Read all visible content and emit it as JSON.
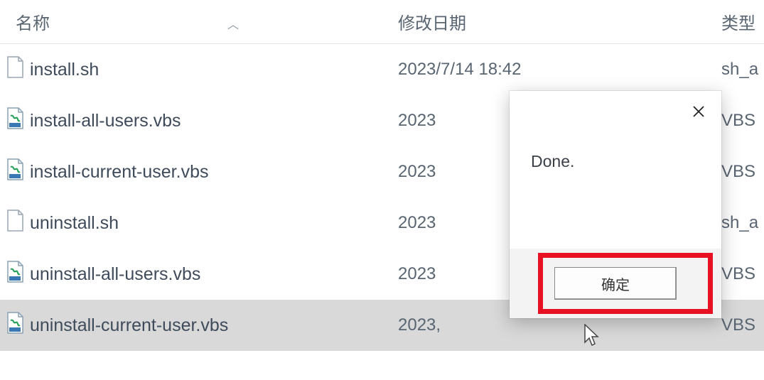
{
  "columns": {
    "name": "名称",
    "date": "修改日期",
    "type": "类型"
  },
  "rows": [
    {
      "icon": "generic",
      "name": "install.sh",
      "date": "2023/7/14 18:42",
      "type": "sh_a",
      "selected": false
    },
    {
      "icon": "vbs",
      "name": "install-all-users.vbs",
      "date": "2023",
      "type": "VBS",
      "selected": false
    },
    {
      "icon": "vbs",
      "name": "install-current-user.vbs",
      "date": "2023",
      "type": "VBS",
      "selected": false
    },
    {
      "icon": "generic",
      "name": "uninstall.sh",
      "date": "2023",
      "type": "sh_a",
      "selected": false
    },
    {
      "icon": "vbs",
      "name": "uninstall-all-users.vbs",
      "date": "2023",
      "type": "VBS",
      "selected": false
    },
    {
      "icon": "vbs",
      "name": "uninstall-current-user.vbs",
      "date": "2023,",
      "type": "VBS",
      "selected": true
    }
  ],
  "dialog": {
    "message": "Done.",
    "ok_label": "确定"
  }
}
